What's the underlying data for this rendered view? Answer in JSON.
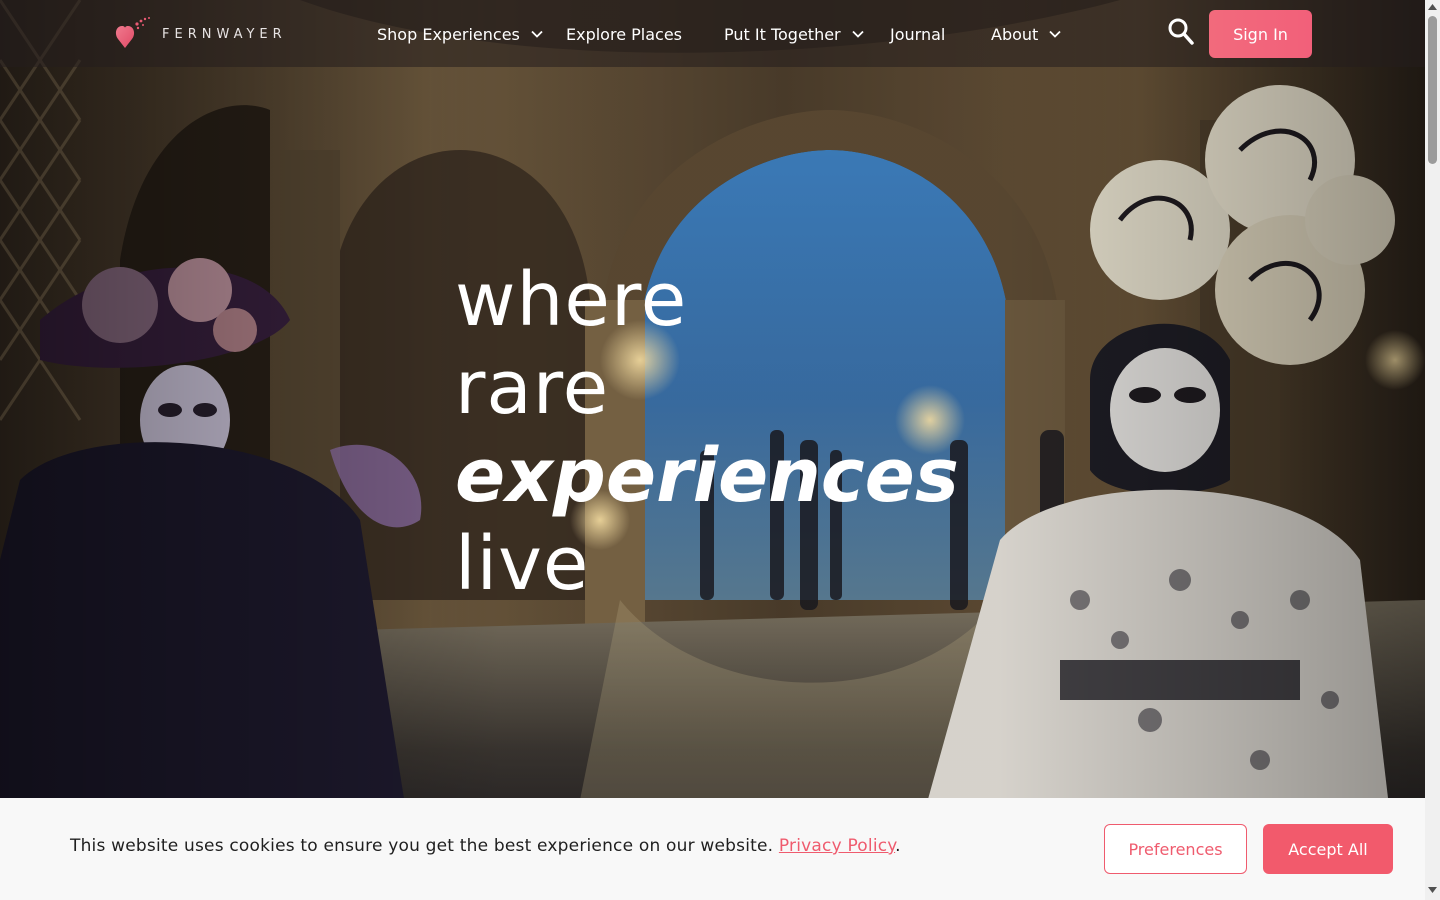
{
  "brand": {
    "name": "FERNWAYER",
    "logo_icon": "heart-balloon-icon"
  },
  "nav": {
    "items": [
      {
        "label": "Shop Experiences",
        "has_dropdown": true
      },
      {
        "label": "Explore Places",
        "has_dropdown": false
      },
      {
        "label": "Put It Together",
        "has_dropdown": true
      },
      {
        "label": "Journal",
        "has_dropdown": false
      },
      {
        "label": "About",
        "has_dropdown": true
      }
    ],
    "search_icon": "search-icon",
    "sign_in_label": "Sign In"
  },
  "hero": {
    "lines": [
      "where",
      "rare",
      "experiences",
      "live"
    ],
    "scene": "venice-carnival-masks-arcade"
  },
  "cookie": {
    "message": "This website uses cookies to ensure you get the best experience on our website.",
    "link_label": "Privacy Policy",
    "link_suffix": ".",
    "preferences_label": "Preferences",
    "accept_label": "Accept All"
  },
  "colors": {
    "accent": "#f25a6c",
    "nav_bg": "#241e1e",
    "banner_bg": "#f8f8f8"
  }
}
